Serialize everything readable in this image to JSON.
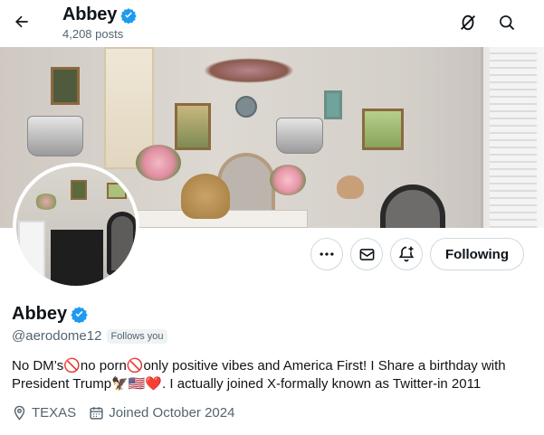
{
  "header": {
    "title": "Abbey",
    "posts_count": "4,208 posts"
  },
  "icons": {
    "back": "arrow-left-icon",
    "unmute": "unmute-icon",
    "search": "search-icon",
    "more": "more-dots-icon",
    "message": "envelope-icon",
    "subscribe": "notification-plus-icon",
    "verified": "verified-badge-icon",
    "location": "location-pin-icon",
    "calendar": "calendar-icon"
  },
  "actions": {
    "follow_label": "Following"
  },
  "profile": {
    "display_name": "Abbey",
    "handle": "@aerodome12",
    "follows_you": "Follows you",
    "bio": "No DM’s🚫no porn🚫only positive vibes and America First! I Share a birthday with President Trump🦅🇺🇸❤️. I actually joined X-formally known as Twitter-in 2011",
    "location": "TEXAS",
    "joined": "Joined October 2024"
  },
  "colors": {
    "verified": "#1d9bf0",
    "secondary_text": "#536471",
    "border": "#cfd9de"
  }
}
